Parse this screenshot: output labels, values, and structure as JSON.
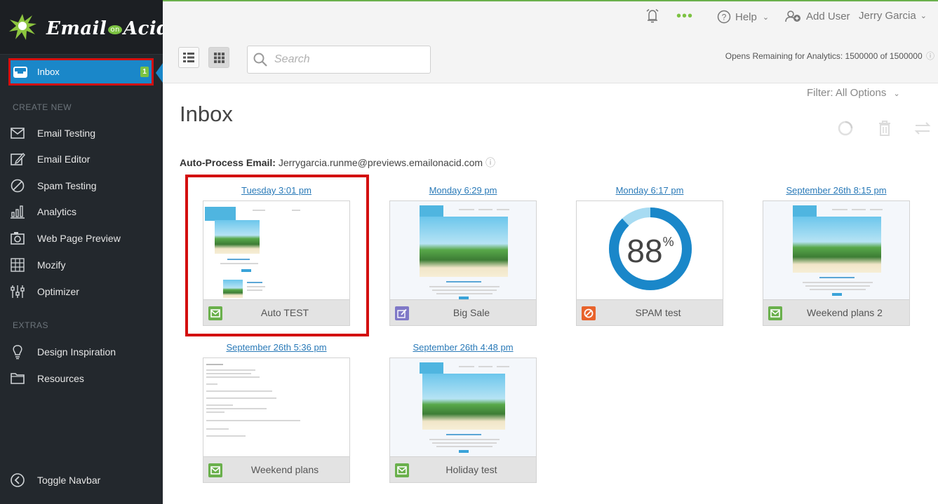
{
  "app": {
    "logo_text_a": "Email",
    "logo_text_on": "on",
    "logo_text_b": "Acid"
  },
  "sidebar": {
    "inbox": {
      "label": "Inbox",
      "badge": "1"
    },
    "create_new_title": "CREATE NEW",
    "create_items": [
      {
        "label": "Email Testing",
        "icon": "envelope-icon"
      },
      {
        "label": "Email Editor",
        "icon": "edit-icon"
      },
      {
        "label": "Spam Testing",
        "icon": "ban-icon"
      },
      {
        "label": "Analytics",
        "icon": "bar-chart-icon"
      },
      {
        "label": "Web Page Preview",
        "icon": "camera-icon"
      },
      {
        "label": "Mozify",
        "icon": "grid-icon"
      },
      {
        "label": "Optimizer",
        "icon": "sliders-icon"
      }
    ],
    "extras_title": "EXTRAS",
    "extras_items": [
      {
        "label": "Design Inspiration",
        "icon": "lightbulb-icon"
      },
      {
        "label": "Resources",
        "icon": "folder-icon"
      }
    ],
    "toggle_label": "Toggle Navbar"
  },
  "topbar": {
    "help_label": "Help",
    "add_user_label": "Add User",
    "user_name": "Jerry Garcia"
  },
  "toolbar": {
    "search_placeholder": "Search",
    "opens_remaining": "Opens Remaining for Analytics: 1500000 of 1500000"
  },
  "main": {
    "title": "Inbox",
    "filter_label": "Filter: All Options",
    "auto_process_label": "Auto-Process Email:",
    "auto_process_email": "Jerrygarcia.runme@previews.emailonacid.com"
  },
  "cards": [
    {
      "date": "Tuesday 3:01 pm",
      "title": "Auto TEST",
      "type": "email"
    },
    {
      "date": "Monday 6:29 pm",
      "title": "Big Sale",
      "type": "editor"
    },
    {
      "date": "Monday 6:17 pm",
      "title": "SPAM test",
      "type": "spam",
      "score": "88",
      "score_unit": "%"
    },
    {
      "date": "September 26th 8:15 pm",
      "title": "Weekend plans 2",
      "type": "email"
    },
    {
      "date": "September 26th 5:36 pm",
      "title": "Weekend plans",
      "type": "email"
    },
    {
      "date": "September 26th 4:48 pm",
      "title": "Holiday test",
      "type": "email"
    }
  ],
  "colors": {
    "accent_blue": "#1a87c9",
    "brand_green": "#7cc242",
    "highlight_red": "#d30f0f",
    "spam_orange": "#e8632c"
  }
}
